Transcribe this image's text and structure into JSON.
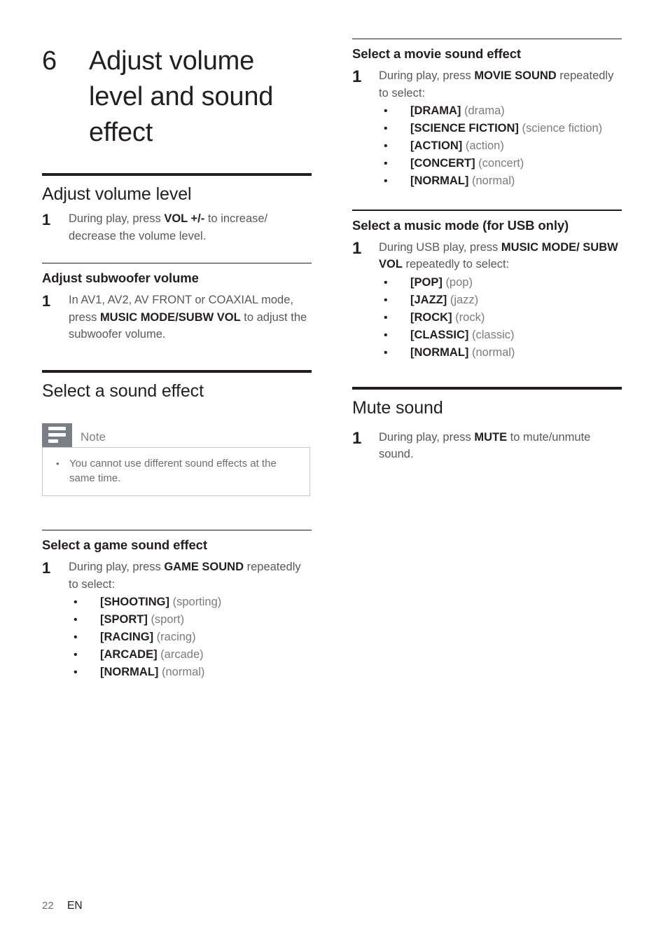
{
  "chapter": {
    "number": "6",
    "title": "Adjust volume level and sound effect"
  },
  "left_column": {
    "section1": {
      "heading": "Adjust volume level",
      "step": {
        "number": "1",
        "text_before": "During play, press ",
        "key": "VOL +/-",
        "text_after": " to increase/ decrease the volume level."
      }
    },
    "section2": {
      "heading": "Adjust subwoofer volume",
      "step": {
        "number": "1",
        "text_before": "In AV1, AV2, AV FRONT or COAXIAL mode, press ",
        "key": "MUSIC MODE/SUBW VOL",
        "text_after": " to adjust the subwoofer volume."
      }
    },
    "section3": {
      "heading": "Select a sound effect",
      "note": {
        "label": "Note",
        "items": [
          "You cannot use different sound effects at the same time."
        ]
      }
    },
    "section4": {
      "heading": "Select a game sound effect",
      "step": {
        "number": "1",
        "text_before": "During play, press ",
        "key": "GAME SOUND",
        "text_after": " repeatedly to select:"
      },
      "options": [
        {
          "term": "[SHOOTING]",
          "desc": "(sporting)"
        },
        {
          "term": "[SPORT]",
          "desc": "(sport)"
        },
        {
          "term": "[RACING]",
          "desc": "(racing)"
        },
        {
          "term": "[ARCADE]",
          "desc": "(arcade)"
        },
        {
          "term": "[NORMAL]",
          "desc": "(normal)"
        }
      ]
    }
  },
  "right_column": {
    "section1": {
      "heading": "Select a movie sound effect",
      "step": {
        "number": "1",
        "text_before": "During play, press ",
        "key": "MOVIE SOUND",
        "text_after": " repeatedly to select:"
      },
      "options": [
        {
          "term": "[DRAMA]",
          "desc": "(drama)"
        },
        {
          "term": "[SCIENCE FICTION]",
          "desc": "(science fiction)"
        },
        {
          "term": "[ACTION]",
          "desc": "(action)"
        },
        {
          "term": "[CONCERT]",
          "desc": "(concert)"
        },
        {
          "term": "[NORMAL]",
          "desc": "(normal)"
        }
      ]
    },
    "section2": {
      "heading": "Select a music mode (for USB only)",
      "step": {
        "number": "1",
        "text_before": "During USB play, press ",
        "key": "MUSIC MODE/ SUBW VOL",
        "text_after": " repeatedly to select:"
      },
      "options": [
        {
          "term": "[POP]",
          "desc": "(pop)"
        },
        {
          "term": "[JAZZ]",
          "desc": "(jazz)"
        },
        {
          "term": "[ROCK]",
          "desc": "(rock)"
        },
        {
          "term": "[CLASSIC]",
          "desc": "(classic)"
        },
        {
          "term": "[NORMAL]",
          "desc": "(normal)"
        }
      ]
    },
    "section3": {
      "heading": "Mute sound",
      "step": {
        "number": "1",
        "text_before": "During play, press ",
        "key": "MUTE",
        "text_after": " to mute/unmute sound."
      }
    }
  },
  "footer": {
    "page_number": "22",
    "language": "EN"
  },
  "colors": {
    "text_dark": "#231f20",
    "text_body": "#58595b",
    "text_muted": "#7a7c7f",
    "note_icon_bg": "#7a7f85",
    "note_border": "#c8c8c8"
  }
}
